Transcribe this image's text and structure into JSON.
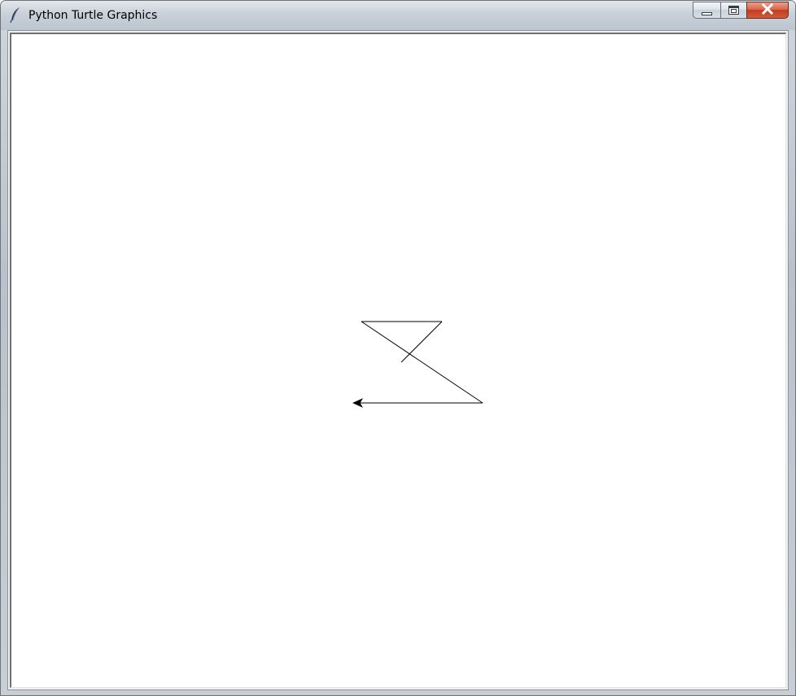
{
  "window": {
    "title": "Python Turtle Graphics",
    "icon": "feather-icon"
  },
  "caption_buttons": [
    {
      "name": "minimize-button",
      "icon": "minimize-icon"
    },
    {
      "name": "maximize-button",
      "icon": "maximize-icon"
    },
    {
      "name": "close-button",
      "icon": "close-icon"
    }
  ],
  "colors": {
    "pen": "#000000",
    "canvas_background": "#ffffff",
    "close_button": "#c7452a"
  },
  "turtle": {
    "shape": "classic-arrow",
    "heading": "west"
  }
}
